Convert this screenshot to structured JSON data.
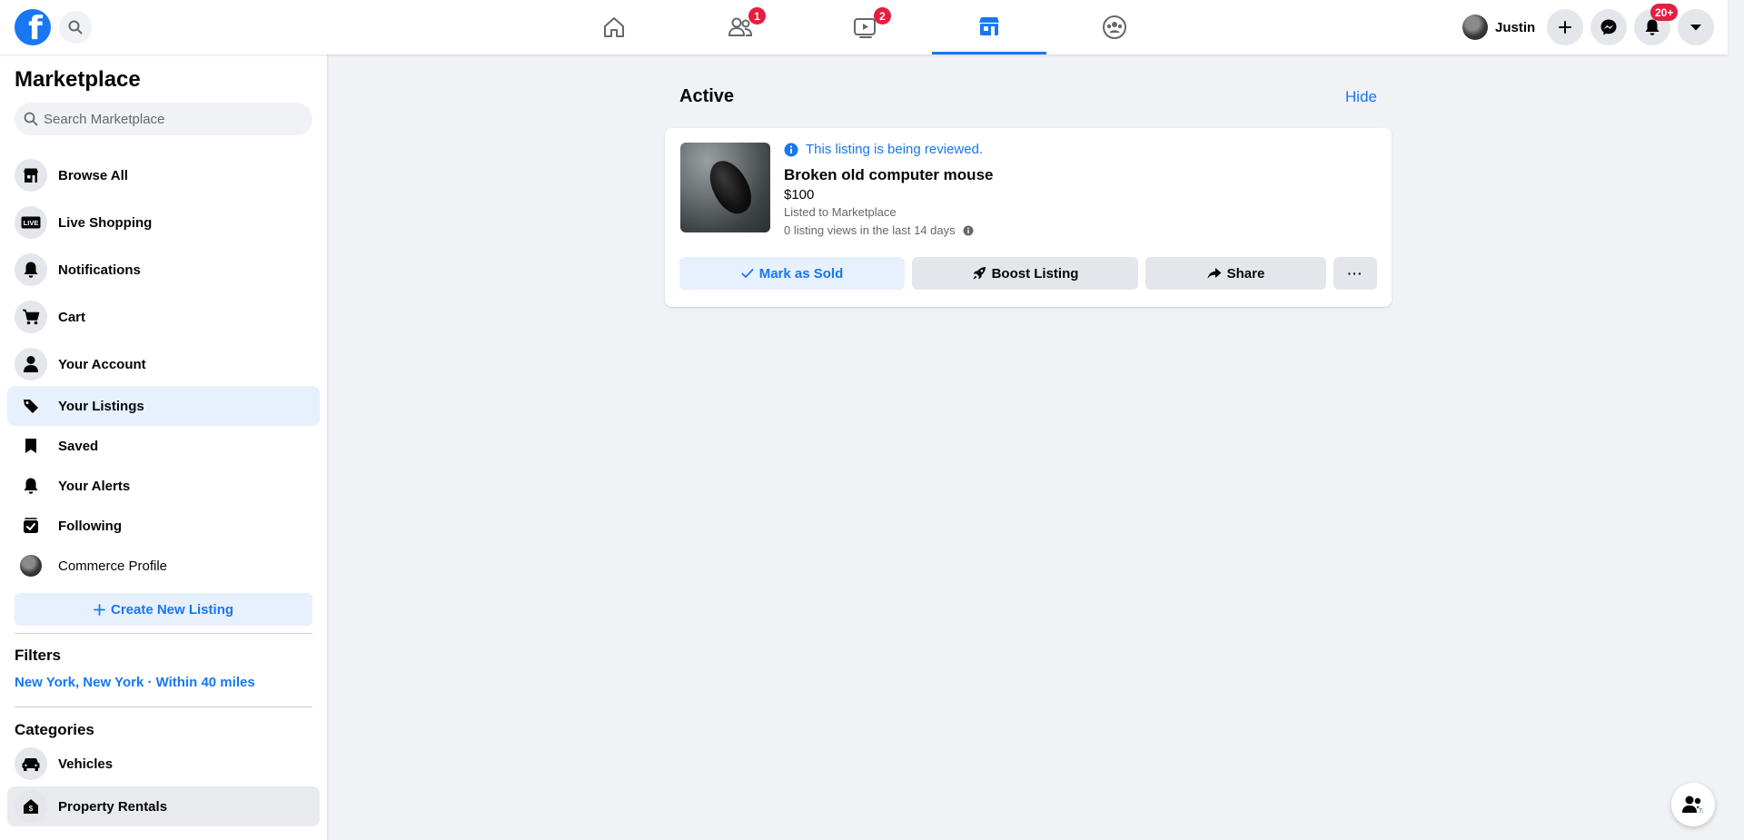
{
  "colors": {
    "accent": "#1877f2",
    "badge": "#e41e3f",
    "active_bg": "#e7f0fd"
  },
  "topbar": {
    "logo_letter": "f",
    "search_icon": "search-icon",
    "tabs": [
      {
        "name": "home",
        "icon": "home-icon",
        "badge": ""
      },
      {
        "name": "friends",
        "icon": "friends-icon",
        "badge": "1"
      },
      {
        "name": "watch",
        "icon": "video-icon",
        "badge": "2"
      },
      {
        "name": "marketplace",
        "icon": "marketplace-icon",
        "badge": "",
        "active": true
      },
      {
        "name": "groups",
        "icon": "groups-icon",
        "badge": ""
      }
    ],
    "profile_name": "Justin",
    "notifications_badge": "20+"
  },
  "sidebar": {
    "title": "Marketplace",
    "search_placeholder": "Search Marketplace",
    "items": [
      {
        "label": "Browse All",
        "icon": "storefront-icon"
      },
      {
        "label": "Live Shopping",
        "icon": "live-icon"
      },
      {
        "label": "Notifications",
        "icon": "bell-icon"
      },
      {
        "label": "Cart",
        "icon": "cart-icon"
      },
      {
        "label": "Your Account",
        "icon": "person-icon"
      }
    ],
    "sub_items": [
      {
        "label": "Your Listings",
        "icon": "tag-icon",
        "active": true
      },
      {
        "label": "Saved",
        "icon": "bookmark-icon"
      },
      {
        "label": "Your Alerts",
        "icon": "alert-bell-icon"
      },
      {
        "label": "Following",
        "icon": "following-icon"
      },
      {
        "label": "Commerce Profile",
        "icon": "avatar"
      }
    ],
    "create_label": "Create New Listing",
    "filters_heading": "Filters",
    "location_filter": "New York, New York · Within 40 miles",
    "categories_heading": "Categories",
    "categories": [
      {
        "label": "Vehicles",
        "icon": "car-icon"
      },
      {
        "label": "Property Rentals",
        "icon": "house-icon"
      }
    ]
  },
  "main": {
    "section_title": "Active",
    "hide_label": "Hide",
    "listing": {
      "review_note": "This listing is being reviewed.",
      "title": "Broken old computer mouse",
      "price": "$100",
      "listed_to": "Listed to Marketplace",
      "views": "0 listing views in the last 14 days",
      "buttons": {
        "mark_sold": "Mark as Sold",
        "boost": "Boost Listing",
        "share": "Share",
        "more": "···"
      }
    }
  }
}
